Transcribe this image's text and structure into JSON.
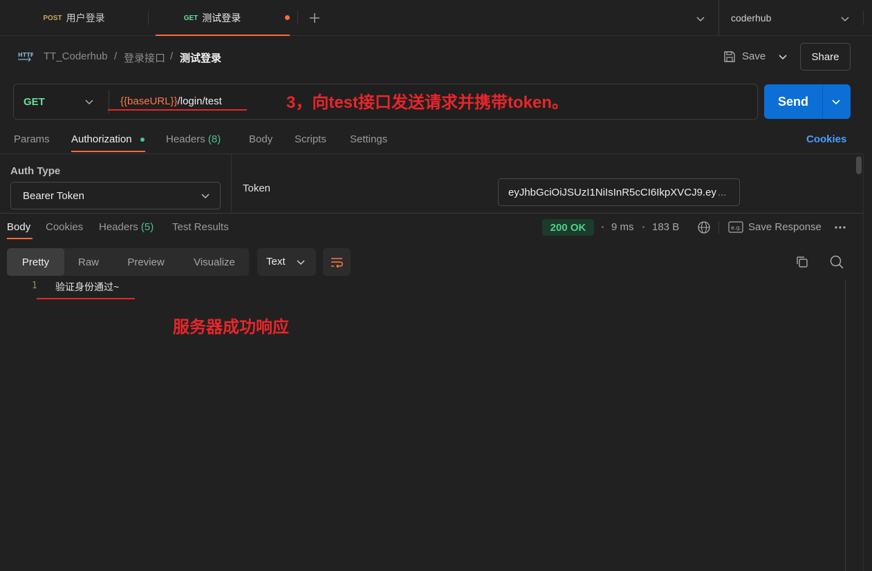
{
  "tabs": [
    {
      "method": "POST",
      "label": "用户登录"
    },
    {
      "method": "GET",
      "label": "测试登录"
    }
  ],
  "workspace": {
    "name": "coderhub"
  },
  "breadcrumb": {
    "collection": "TT_Coderhub",
    "folder": "登录接口",
    "request": "测试登录",
    "separator": "/"
  },
  "toolbar": {
    "save_label": "Save",
    "share_label": "Share"
  },
  "request": {
    "method": "GET",
    "url_variable": "{{baseURL}}",
    "url_path": "/login/test",
    "send_label": "Send"
  },
  "request_tabs": {
    "params": "Params",
    "authorization": "Authorization",
    "headers": "Headers",
    "headers_count": "(8)",
    "body": "Body",
    "scripts": "Scripts",
    "settings": "Settings",
    "cookies": "Cookies"
  },
  "auth": {
    "type_label": "Auth Type",
    "type_value": "Bearer Token",
    "token_label": "Token",
    "token_value": "eyJhbGciOiJSUzI1NiIsInR5cCI6IkpXVCJ9.ey",
    "token_ellipsis": "..."
  },
  "response_tabs": {
    "body": "Body",
    "cookies": "Cookies",
    "headers": "Headers",
    "headers_count": "(5)",
    "test_results": "Test Results"
  },
  "response": {
    "status": "200 OK",
    "time": "9 ms",
    "size": "183 B",
    "save_label": "Save Response"
  },
  "views": {
    "pretty": "Pretty",
    "raw": "Raw",
    "preview": "Preview",
    "visualize": "Visualize",
    "format": "Text"
  },
  "code": {
    "line_number": "1",
    "text": "验证身份通过~"
  },
  "annotations": {
    "step": "3，向test接口发送请求并携带token。",
    "result": "服务器成功响应"
  },
  "colors": {
    "accent": "#ff6c37",
    "send": "#0b6fd6",
    "success": "#4cd38e",
    "annotation": "#e8262a"
  }
}
